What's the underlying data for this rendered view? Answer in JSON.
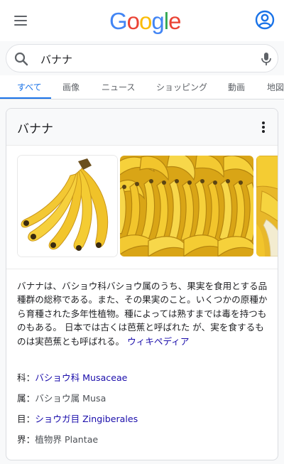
{
  "header": {
    "logo_letters": [
      {
        "ch": "G",
        "color": "#4285F4"
      },
      {
        "ch": "o",
        "color": "#EA4335"
      },
      {
        "ch": "o",
        "color": "#FBBC05"
      },
      {
        "ch": "g",
        "color": "#4285F4"
      },
      {
        "ch": "l",
        "color": "#34A853"
      },
      {
        "ch": "e",
        "color": "#EA4335"
      }
    ],
    "menu_icon": "hamburger-icon",
    "account_icon": "account-circle-icon",
    "account_color": "#1a73e8"
  },
  "search": {
    "query": "バナナ",
    "search_icon": "search-icon",
    "mic_icon": "mic-icon"
  },
  "tabs": [
    {
      "label": "すべて",
      "active": true
    },
    {
      "label": "画像",
      "active": false
    },
    {
      "label": "ニュース",
      "active": false
    },
    {
      "label": "ショッピング",
      "active": false
    },
    {
      "label": "動画",
      "active": false
    },
    {
      "label": "地図",
      "active": false
    }
  ],
  "knowledge_panel": {
    "title": "バナナ",
    "more_icon": "more-vert-icon",
    "description": "バナナは、バショウ科バショウ属のうち、果実を食用とする品種群の総称である。また、その果実のこと。いくつかの原種から育種された多年性植物。種によっては熟すまでは毒を持つものもある。 日本では古くは芭蕉と呼ばれた が、実を食するものは実芭蕉とも呼ばれる。",
    "wiki_link": "ウィキペディア",
    "facts": [
      {
        "key": "科：",
        "value": "バショウ科 Musaceae",
        "is_link": true
      },
      {
        "key": "属：",
        "value": "バショウ属 Musa",
        "is_link": false
      },
      {
        "key": "目：",
        "value": "ショウガ目 Zingiberales",
        "is_link": true
      },
      {
        "key": "界：",
        "value": "植物界 Plantae",
        "is_link": false
      }
    ]
  },
  "colors": {
    "accent": "#1a73e8",
    "link": "#1a0dab",
    "banana_yellow": "#f2c12e"
  }
}
